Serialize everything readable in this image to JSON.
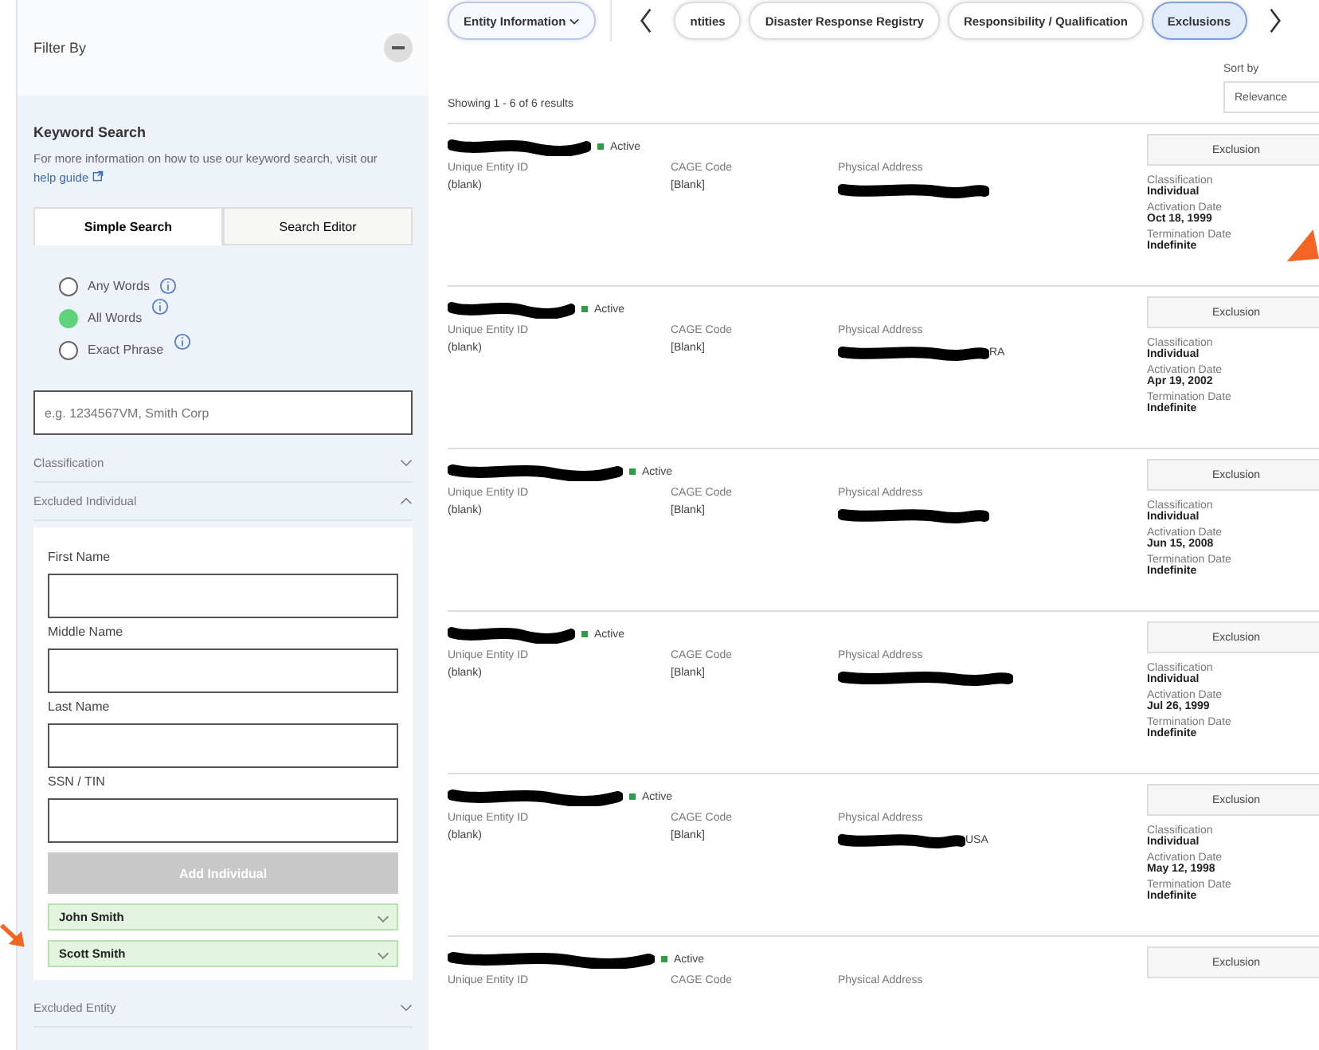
{
  "sidebar": {
    "title": "Filter By",
    "keyword_search": {
      "heading": "Keyword Search",
      "help_text": "For more information on how to use our keyword search, visit our",
      "help_link": "help guide",
      "tabs": [
        {
          "label": "Simple Search",
          "selected": true
        },
        {
          "label": "Search Editor",
          "selected": false
        }
      ],
      "options": [
        {
          "label": "Any Words",
          "selected": false
        },
        {
          "label": "All Words",
          "selected": true
        },
        {
          "label": "Exact Phrase",
          "selected": false
        }
      ],
      "placeholder": "e.g. 1234567VM, Smith Corp"
    },
    "sections": [
      {
        "label": "Classification",
        "expanded": false
      },
      {
        "label": "Excluded Individual",
        "expanded": true,
        "fields": [
          {
            "label": "First Name"
          },
          {
            "label": "Middle Name"
          },
          {
            "label": "Last Name"
          },
          {
            "label": "SSN / TIN"
          }
        ],
        "button": {
          "label": "Add Individual",
          "disabled": true
        },
        "chips": [
          {
            "label": "John Smith"
          },
          {
            "label": "Scott Smith"
          }
        ]
      },
      {
        "label": "Excluded Entity",
        "expanded": false
      }
    ]
  },
  "nav": {
    "tabs": [
      {
        "label": "Entity Information",
        "selected": false,
        "kind": "menu"
      },
      {
        "label": "ntities",
        "selected": false,
        "kind": "tab"
      },
      {
        "label": "Disaster Response Registry",
        "selected": false,
        "kind": "tab"
      },
      {
        "label": "Responsibility / Qualification",
        "selected": false,
        "kind": "tab"
      },
      {
        "label": "Exclusions",
        "selected": true,
        "kind": "tab"
      }
    ]
  },
  "results": {
    "summary": "Showing 1 - 6 of 6 results",
    "sort_label": "Sort by",
    "sort_value": "Relevance",
    "rows": [
      {
        "status": "Active",
        "uei_label": "Unique Entity ID",
        "uei": "(blank)",
        "cage_label": "CAGE Code",
        "cage": "[Blank]",
        "address_label": "Physical Address",
        "button": "Exclusion",
        "classification_label": "Classification",
        "classification": "Individual",
        "activation_label": "Activation Date",
        "activation": "Oct 18, 1999",
        "termination_label": "Termination Date",
        "termination": "Indefinite"
      },
      {
        "status": "Active",
        "uei_label": "Unique Entity ID",
        "uei": "(blank)",
        "cage_label": "CAGE Code",
        "cage": "[Blank]",
        "address_label": "Physical Address",
        "address_tail": "RA",
        "button": "Exclusion",
        "classification_label": "Classification",
        "classification": "Individual",
        "activation_label": "Activation Date",
        "activation": "Apr 19, 2002",
        "termination_label": "Termination Date",
        "termination": "Indefinite"
      },
      {
        "status": "Active",
        "uei_label": "Unique Entity ID",
        "uei": "(blank)",
        "cage_label": "CAGE Code",
        "cage": "[Blank]",
        "address_label": "Physical Address",
        "button": "Exclusion",
        "classification_label": "Classification",
        "classification": "Individual",
        "activation_label": "Activation Date",
        "activation": "Jun 15, 2008",
        "termination_label": "Termination Date",
        "termination": "Indefinite"
      },
      {
        "status": "Active",
        "uei_label": "Unique Entity ID",
        "uei": "(blank)",
        "cage_label": "CAGE Code",
        "cage": "[Blank]",
        "address_label": "Physical Address",
        "button": "Exclusion",
        "classification_label": "Classification",
        "classification": "Individual",
        "activation_label": "Activation Date",
        "activation": "Jul 26, 1999",
        "termination_label": "Termination Date",
        "termination": "Indefinite"
      },
      {
        "status": "Active",
        "uei_label": "Unique Entity ID",
        "uei": "(blank)",
        "cage_label": "CAGE Code",
        "cage": "[Blank]",
        "address_label": "Physical Address",
        "address_tail": "USA",
        "button": "Exclusion",
        "classification_label": "Classification",
        "classification": "Individual",
        "activation_label": "Activation Date",
        "activation": "May 12, 1998",
        "termination_label": "Termination Date",
        "termination": "Indefinite"
      },
      {
        "status": "Active",
        "uei_label": "Unique Entity ID",
        "cage_label": "CAGE Code",
        "address_label": "Physical Address",
        "button": "Exclusion"
      }
    ]
  }
}
